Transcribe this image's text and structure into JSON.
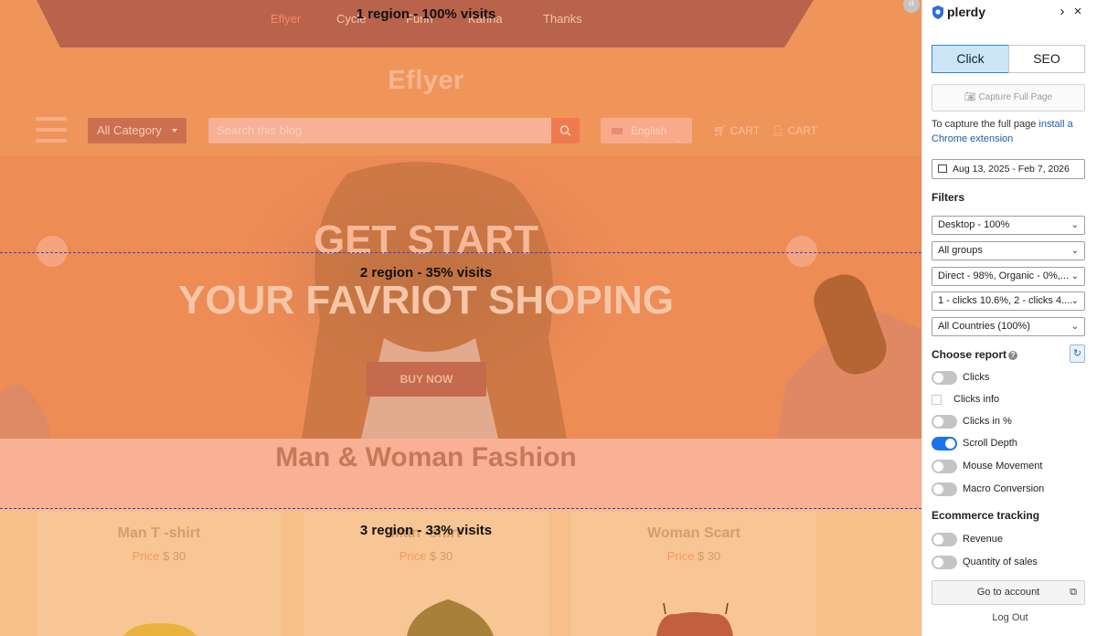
{
  "site": {
    "nav": [
      "Eflyer",
      "Cycle",
      "Funn",
      "Kanna",
      "Thanks"
    ],
    "brand": "Eflyer",
    "category_label": "All Category",
    "search_placeholder": "Search this blog",
    "language": "English",
    "cart_labels": [
      "CART",
      "CART"
    ],
    "hero_title1": "GET START",
    "hero_title2": "YOUR FAVRIOT SHOPING",
    "buy_label": "BUY NOW",
    "section_title": "Man & Woman Fashion",
    "price_label": "Price",
    "products": [
      {
        "name": "Man T -shirt",
        "price": "$ 30"
      },
      {
        "name": "Man -shirt",
        "price": "$ 30"
      },
      {
        "name": "Woman Scart",
        "price": "$ 30"
      }
    ]
  },
  "scroll_regions": [
    {
      "label": "1 region - 100% visits",
      "visits_pct": 100
    },
    {
      "label": "2 region - 35% visits",
      "visits_pct": 35
    },
    {
      "label": "3 region - 33% visits",
      "visits_pct": 33
    }
  ],
  "panel": {
    "brand": "plerdy",
    "tabs": [
      "Click",
      "SEO"
    ],
    "active_tab": "Click",
    "capture_label": "Capture Full Page",
    "note_text": "To capture the full page ",
    "note_link": "install a Chrome extension",
    "date_range": "Aug 13, 2025 - Feb 7, 2026",
    "filters_title": "Filters",
    "filters": [
      "Desktop - 100%",
      "All groups",
      "Direct - 98%, Organic - 0%,...",
      "1 - clicks 10.6%, 2 - clicks 4....",
      "All Countries (100%)"
    ],
    "report_title": "Choose report",
    "reports": [
      {
        "label": "Clicks",
        "kind": "toggle",
        "on": false
      },
      {
        "label": "Clicks info",
        "kind": "checkbox",
        "on": false
      },
      {
        "label": "Clicks in %",
        "kind": "toggle",
        "on": false
      },
      {
        "label": "Scroll Depth",
        "kind": "toggle",
        "on": true
      },
      {
        "label": "Mouse Movement",
        "kind": "toggle",
        "on": false
      },
      {
        "label": "Macro Conversion",
        "kind": "toggle",
        "on": false
      }
    ],
    "ecommerce_title": "Ecommerce tracking",
    "ecommerce": [
      {
        "label": "Revenue",
        "on": false
      },
      {
        "label": "Quantity of sales",
        "on": false
      }
    ],
    "account_label": "Go to account",
    "logout_label": "Log Out"
  },
  "colors": {
    "accent": "#1a73e8",
    "overlay_top": "#f0955a",
    "scroll_line": "#3a3fd0"
  }
}
